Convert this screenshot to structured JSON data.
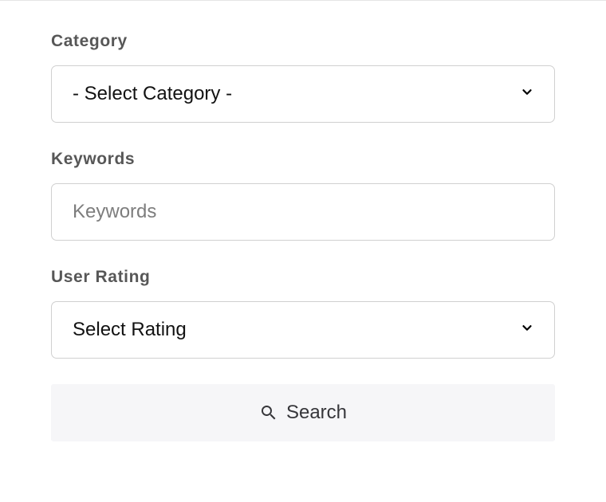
{
  "form": {
    "category": {
      "label": "Category",
      "selected": "- Select Category -"
    },
    "keywords": {
      "label": "Keywords",
      "placeholder": "Keywords",
      "value": ""
    },
    "rating": {
      "label": "User Rating",
      "selected": "Select Rating"
    },
    "search_button": {
      "label": "Search"
    }
  }
}
